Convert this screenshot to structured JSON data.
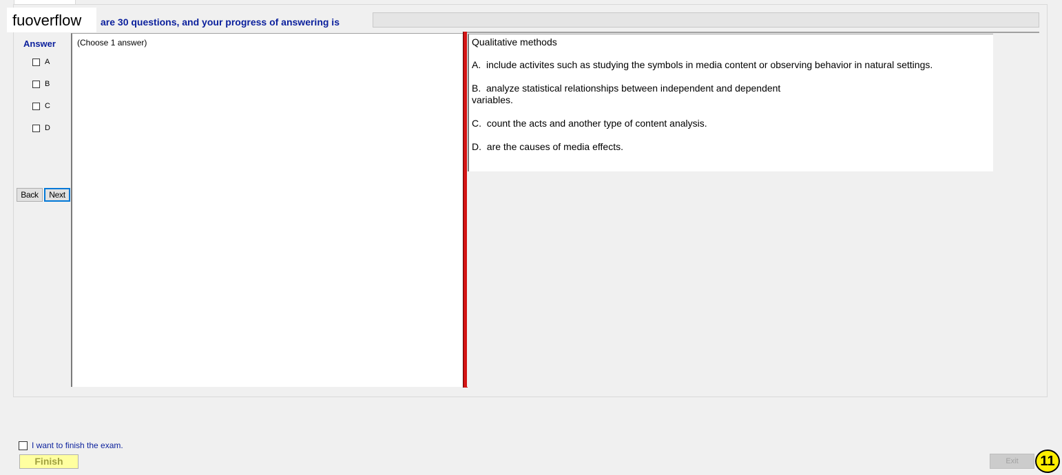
{
  "header": {
    "watermark": "fuoverflow",
    "progress_text": "are 30 questions, and your progress of answering is",
    "progress_fraction": 0
  },
  "answer_panel": {
    "title": "Answer",
    "options": [
      {
        "label": "A",
        "checked": false
      },
      {
        "label": "B",
        "checked": false
      },
      {
        "label": "C",
        "checked": false
      },
      {
        "label": "D",
        "checked": false
      }
    ],
    "back_label": "Back",
    "next_label": "Next"
  },
  "left_pane": {
    "instruction": "(Choose 1 answer)"
  },
  "question": {
    "title": "Qualitative methods",
    "options": [
      "A.  include activites such as studying the symbols in media content or observing behavior in natural settings.",
      "B.  analyze statistical relationships between independent and dependent\nvariables.",
      "C.  count the acts and another type of content analysis.",
      "D.  are the causes of media effects."
    ]
  },
  "footer": {
    "finish_check_label": "I want to finish the exam.",
    "finish_label": "Finish",
    "exit_label": "Exit",
    "badge": "11"
  },
  "colors": {
    "accent_text": "#0a1f9c",
    "splitter": "#d21414",
    "finish_bg": "#ffffa0",
    "badge_bg": "#ffee00"
  }
}
